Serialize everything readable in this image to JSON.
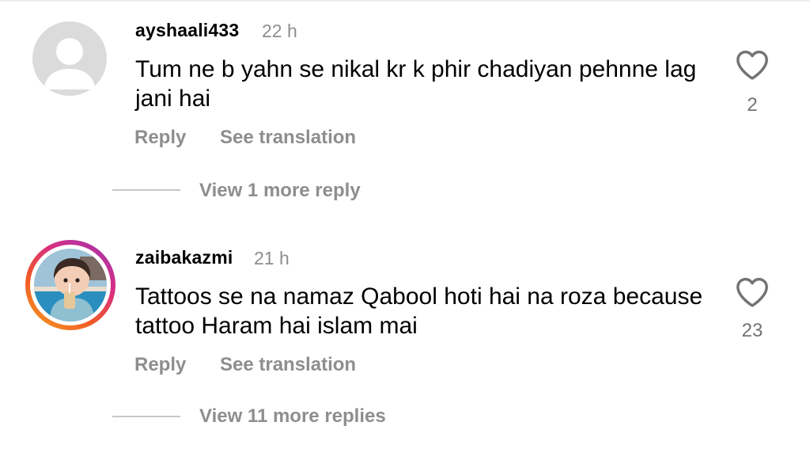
{
  "comments": [
    {
      "username": "ayshaali433",
      "time": "22 h",
      "text": "Tum ne b yahn se nikal kr k phir chadiyan pehnne lag jani hai",
      "reply_label": "Reply",
      "translate_label": "See translation",
      "likes": "2",
      "view_replies": "View 1 more reply",
      "avatar": "default-avatar-icon"
    },
    {
      "username": "zaibakazmi",
      "time": "21 h",
      "text": "Tattoos se na namaz Qabool hoti hai na roza because tattoo Haram hai islam mai",
      "reply_label": "Reply",
      "translate_label": "See translation",
      "likes": "23",
      "view_replies": "View 11 more replies",
      "avatar": "story-ring-avatar"
    }
  ],
  "colors": {
    "secondary_text": "#8e8e8e",
    "thread_line": "#c7c7c7",
    "default_avatar": "#dbdbdb",
    "story_ring": [
      "#f9a325",
      "#d92e7f",
      "#9b36b7"
    ]
  }
}
